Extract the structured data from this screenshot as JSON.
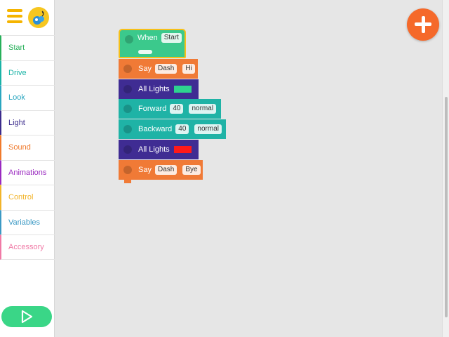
{
  "sidebar": {
    "categories": [
      {
        "label": "Start",
        "color": "#27b05a"
      },
      {
        "label": "Drive",
        "color": "#19b3a6"
      },
      {
        "label": "Look",
        "color": "#2aa6c0"
      },
      {
        "label": "Light",
        "color": "#3b2b8c"
      },
      {
        "label": "Sound",
        "color": "#f07a2c"
      },
      {
        "label": "Animations",
        "color": "#9a2ac0"
      },
      {
        "label": "Control",
        "color": "#f2b42a"
      },
      {
        "label": "Variables",
        "color": "#3b99c4"
      },
      {
        "label": "Accessory",
        "color": "#f07aa6"
      }
    ]
  },
  "program": {
    "when": {
      "label": "When",
      "trigger": "Start"
    },
    "blocks": [
      {
        "label": "Say",
        "args": [
          "Dash",
          "Hi"
        ],
        "color": "#f07a36"
      },
      {
        "label": "All Lights",
        "swatch": "#2ed38f",
        "color": "#3f2c93"
      },
      {
        "label": "Forward",
        "args": [
          "40",
          "normal"
        ],
        "color": "#1fb3a6"
      },
      {
        "label": "Backward",
        "args": [
          "40",
          "normal"
        ],
        "color": "#1fb3a6"
      },
      {
        "label": "All Lights",
        "swatch": "#ff1a1a",
        "color": "#3f2c93"
      },
      {
        "label": "Say",
        "args": [
          "Dash",
          "Bye"
        ],
        "color": "#f07a36"
      }
    ]
  },
  "icons": {
    "menu": "menu-icon",
    "robot": "robot-avatar-icon",
    "add": "plus-icon",
    "play": "play-icon"
  }
}
